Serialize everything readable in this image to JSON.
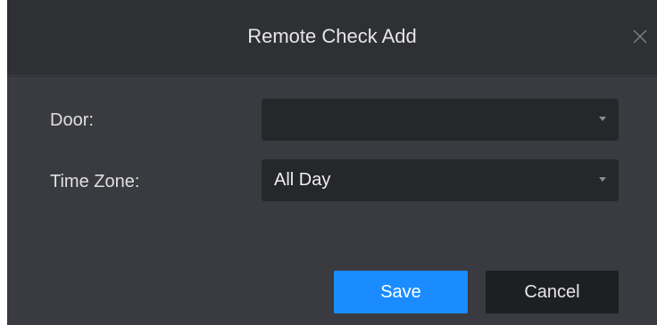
{
  "dialog": {
    "title": "Remote Check Add",
    "close_icon": "close-icon"
  },
  "form": {
    "door": {
      "label": "Door:",
      "value": ""
    },
    "time_zone": {
      "label": "Time Zone:",
      "value": "All Day"
    }
  },
  "actions": {
    "save_label": "Save",
    "cancel_label": "Cancel"
  },
  "colors": {
    "accent": "#1a8cff",
    "dialog_bg": "#3a3b40",
    "titlebar_bg": "#2f3034",
    "input_bg": "#26272b"
  }
}
